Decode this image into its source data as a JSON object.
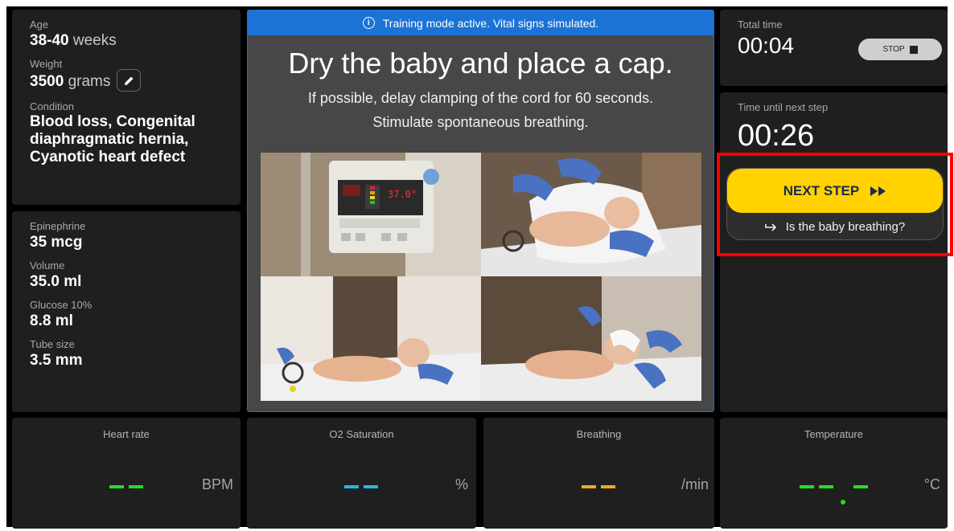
{
  "patient": {
    "age_label": "Age",
    "age_value": "38-40",
    "age_unit": "weeks",
    "weight_label": "Weight",
    "weight_value": "3500",
    "weight_unit": "grams",
    "condition_label": "Condition",
    "condition_value": "Blood loss, Congenital diaphragmatic hernia, Cyanotic heart defect"
  },
  "dosing": {
    "epinephrine_label": "Epinephrine",
    "epinephrine_value": "35 mcg",
    "volume_label": "Volume",
    "volume_value": "35.0 ml",
    "glucose_label": "Glucose 10%",
    "glucose_value": "8.8 ml",
    "tube_label": "Tube size",
    "tube_value": "3.5 mm"
  },
  "instruction": {
    "banner": "Training mode active. Vital signs simulated.",
    "title": "Dry the baby and place a cap.",
    "line1": "If possible, delay clamping of the cord for 60 seconds.",
    "line2": "Stimulate spontaneous breathing.",
    "monitor_reading": "37.0°"
  },
  "timer": {
    "total_label": "Total time",
    "total_value": "00:04",
    "stop_label": "STOP",
    "next_label": "Time until next step",
    "next_value": "00:26"
  },
  "next_step": {
    "button_label": "NEXT STEP",
    "question": "Is the baby breathing?"
  },
  "vitals": [
    {
      "title": "Heart rate",
      "display": "——",
      "unit": "BPM",
      "color": "#22dd22"
    },
    {
      "title": "O2 Saturation",
      "display": "——",
      "unit": "%",
      "color": "#1fb8e6"
    },
    {
      "title": "Breathing",
      "display": "——",
      "unit": "/min",
      "color": "#f2a81d"
    },
    {
      "title": "Temperature",
      "display": "—— —",
      "unit": "°C",
      "color": "#22dd22"
    }
  ],
  "colors": {
    "panel": "#1f1f1f",
    "accent_blue": "#1c73d6",
    "next_yellow": "#ffd200",
    "highlight_red": "#ff0000"
  }
}
